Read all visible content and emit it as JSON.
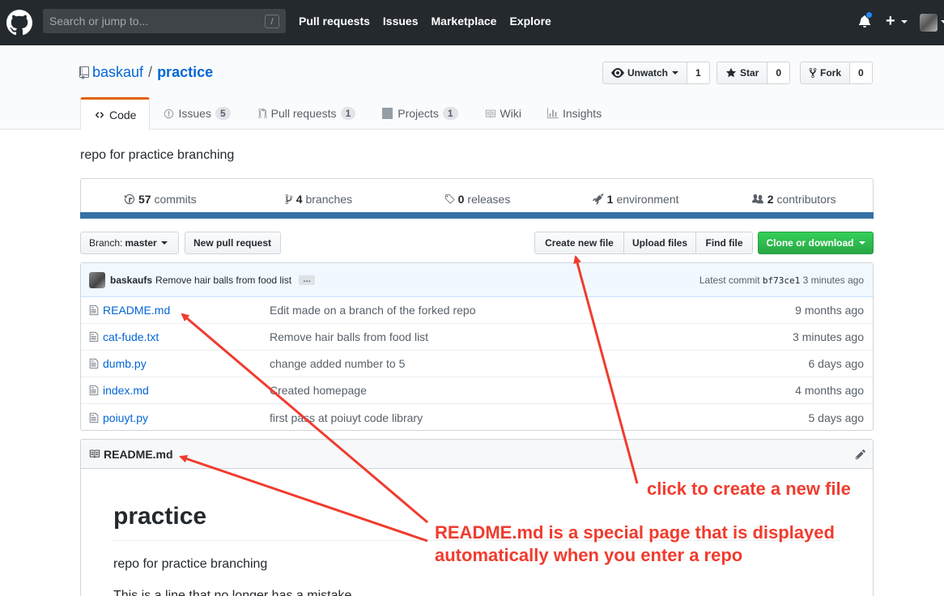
{
  "header": {
    "search_placeholder": "Search or jump to...",
    "search_key": "/",
    "nav": [
      "Pull requests",
      "Issues",
      "Marketplace",
      "Explore"
    ],
    "plus": "+"
  },
  "repo": {
    "owner": "baskauf",
    "separator": "/",
    "name": "practice",
    "unwatch_label": "Unwatch",
    "watch_count": "1",
    "star_label": "Star",
    "star_count": "0",
    "fork_label": "Fork",
    "fork_count": "0",
    "description": "repo for practice branching"
  },
  "tabs": [
    {
      "label": "Code",
      "count": ""
    },
    {
      "label": "Issues",
      "count": "5"
    },
    {
      "label": "Pull requests",
      "count": "1"
    },
    {
      "label": "Projects",
      "count": "1"
    },
    {
      "label": "Wiki",
      "count": ""
    },
    {
      "label": "Insights",
      "count": ""
    }
  ],
  "summary": {
    "commits_n": "57",
    "commits_label": "commits",
    "branches_n": "4",
    "branches_label": "branches",
    "releases_n": "0",
    "releases_label": "releases",
    "env_n": "1",
    "env_label": "environment",
    "contrib_n": "2",
    "contrib_label": "contributors"
  },
  "language_bar_color": "#3572A5",
  "toolbar": {
    "branch_prefix": "Branch:",
    "branch_name": "master",
    "new_pr": "New pull request",
    "create_file": "Create new file",
    "upload_files": "Upload files",
    "find_file": "Find file",
    "clone": "Clone or download"
  },
  "commit": {
    "user": "baskaufs",
    "message": "Remove hair balls from food list",
    "ellipsis": "…",
    "latest_label": "Latest commit",
    "sha": "bf73ce1",
    "age": "3 minutes ago"
  },
  "files": [
    {
      "name": "README.md",
      "message": "Edit made on a branch of the forked repo",
      "age": "9 months ago"
    },
    {
      "name": "cat-fude.txt",
      "message": "Remove hair balls from food list",
      "age": "3 minutes ago"
    },
    {
      "name": "dumb.py",
      "message": "change added number to 5",
      "age": "6 days ago"
    },
    {
      "name": "index.md",
      "message": "Created homepage",
      "age": "4 months ago"
    },
    {
      "name": "poiuyt.py",
      "message": "first pass at poiuyt code library",
      "age": "5 days ago"
    }
  ],
  "readme": {
    "filename": "README.md",
    "h1": "practice",
    "p1": "repo for practice branching",
    "p2": "This is a line that no longer has a mistake."
  },
  "annotations": {
    "create_note": "click to create a new file",
    "readme_note_line1": "README.md is a special page that is displayed",
    "readme_note_line2": "automatically when you enter a repo",
    "color": "#f03c2e"
  }
}
